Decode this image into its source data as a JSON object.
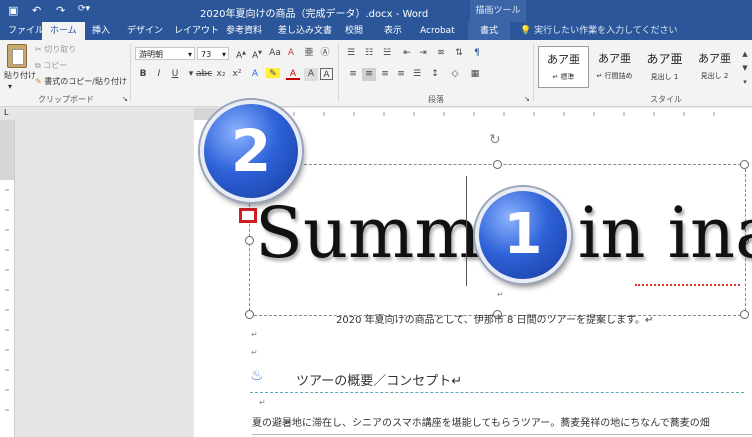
{
  "title_bar": {
    "document_title": "2020年夏向けの商品（完成データ）.docx - Word",
    "context_group": "描画ツール",
    "quick_access": {
      "save_icon": "save-icon",
      "undo_icon": "undo-icon",
      "redo_icon": "redo-icon",
      "repeat_icon": "repeat-icon"
    }
  },
  "tabs": [
    "ファイル",
    "ホーム",
    "挿入",
    "デザイン",
    "レイアウト",
    "参考資料",
    "差し込み文書",
    "校閲",
    "表示",
    "Acrobat",
    "書式"
  ],
  "tell_me": "実行したい作業を入力してください",
  "ribbon": {
    "clipboard": {
      "paste_label": "貼り付け",
      "cut_label": "切り取り",
      "copy_label": "コピー",
      "format_painter_label": "書式のコピー/貼り付け",
      "group_label": "クリップボード"
    },
    "font": {
      "name": "游明朝",
      "size": "73"
    },
    "paragraph": {
      "group_label": "段落"
    },
    "styles": {
      "group_label": "スタイル",
      "items": [
        {
          "sample": "あア亜",
          "label": "↵ 標準"
        },
        {
          "sample": "あア亜",
          "label": "↵ 行間詰め"
        },
        {
          "sample": "あア亜",
          "label": "見出し 1"
        },
        {
          "sample": "あア亜",
          "label": "見出し 2"
        }
      ]
    }
  },
  "document": {
    "big_text": "Summer in ina",
    "subtitle": "2020 年夏向けの商品として、伊那市 8 日間のツアーを提案します。↵",
    "heading": "ツアーの概要／コンセプト↵",
    "body_line": "夏の避暑地に滞在し、シニアのスマホ講座を堪能してもらうツアー。蕎麦発祥の地にちなんで蕎麦の畑"
  },
  "callouts": {
    "one": "1",
    "two": "2"
  },
  "colors": {
    "word_blue": "#2b579a",
    "callout_blue": "#2e62d8",
    "marker_red": "#cc1f1f"
  }
}
